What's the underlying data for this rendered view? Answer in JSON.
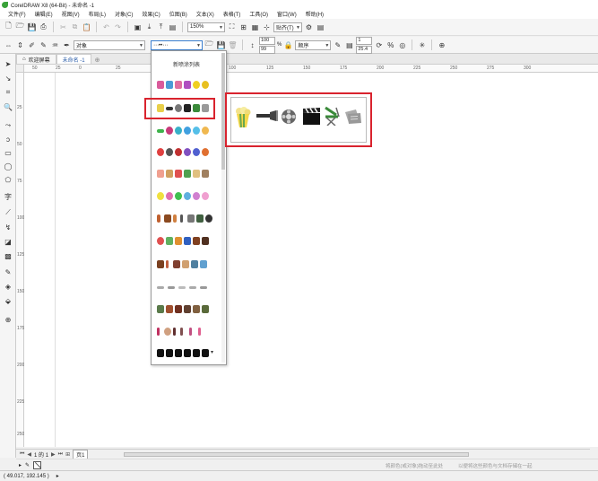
{
  "window": {
    "title": "CorelDRAW X8 (64-Bit) - 未命名 -1"
  },
  "menu": [
    "文件(F)",
    "编辑(E)",
    "视图(V)",
    "布局(L)",
    "对象(C)",
    "效果(C)",
    "位图(B)",
    "文本(X)",
    "表格(T)",
    "工具(O)",
    "窗口(W)",
    "帮助(H)"
  ],
  "toolbar": {
    "zoom_value": "150%",
    "snap_label": "贴齐(T)"
  },
  "propertybar": {
    "object_combo": "对象",
    "brush_combo": "⋯••⋯",
    "size_value": "100",
    "size_unit": "%",
    "size_value2": "99",
    "order_combo": "顺序",
    "spin_top": "1",
    "spin_bottom": "25.4"
  },
  "tabs": {
    "welcome": "欢迎屏幕",
    "doc": "未命名 -1"
  },
  "dropdown": {
    "title": "新喷涂列表"
  },
  "ruler": {
    "h_labels": [
      "50",
      "25",
      "0",
      "25",
      "50",
      "75",
      "100",
      "125",
      "150",
      "175",
      "200",
      "225",
      "250",
      "275",
      "300"
    ],
    "v_labels": [
      "25",
      "50",
      "75",
      "100",
      "125",
      "150",
      "175",
      "200",
      "225",
      "250",
      "275",
      "300",
      "325",
      "350"
    ]
  },
  "pagebar": {
    "page_info": "1 的 1",
    "page_tab": "页1"
  },
  "hints": {
    "left": "将颜色(或对象)拖动至此处",
    "right": "以便将这些颜色与文档存储在一起"
  },
  "status": {
    "coords": "( 49.017, 192.145 )"
  },
  "colors": {
    "highlight": "#d9232e",
    "accent": "#3b7fd0"
  }
}
